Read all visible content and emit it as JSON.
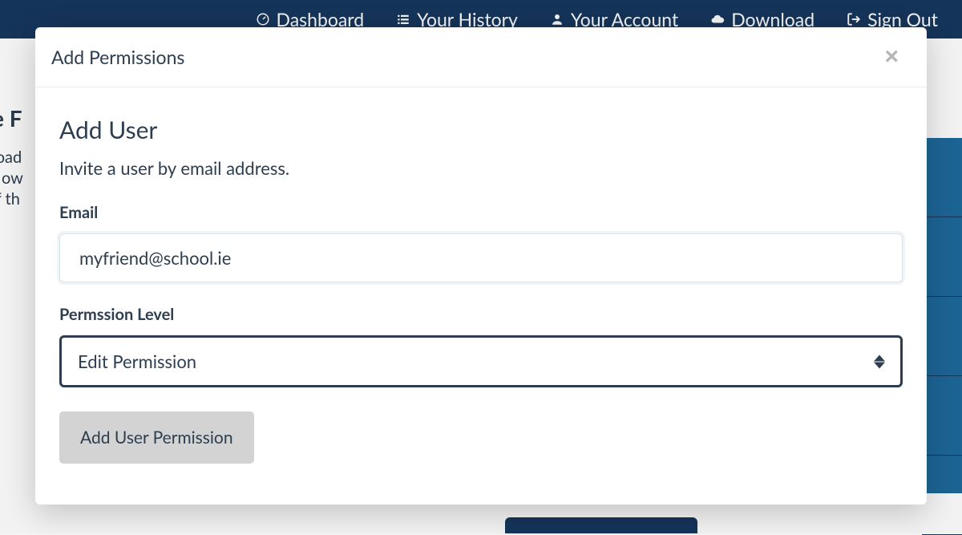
{
  "nav": {
    "dashboard": "Dashboard",
    "history": "Your History",
    "account": "Your Account",
    "download": "Download",
    "signout": "Sign Out"
  },
  "bg": {
    "title_fragment": "e F",
    "line1": "load",
    "line2": "r ow",
    "line3": "if th"
  },
  "modal": {
    "title": "Add Permissions",
    "section_heading": "Add User",
    "section_desc": "Invite a user by email address.",
    "email_label": "Email",
    "email_value": "myfriend@school.ie",
    "permission_label": "Permssion Level",
    "permission_value": "Edit Permission",
    "submit_label": "Add User Permission"
  }
}
